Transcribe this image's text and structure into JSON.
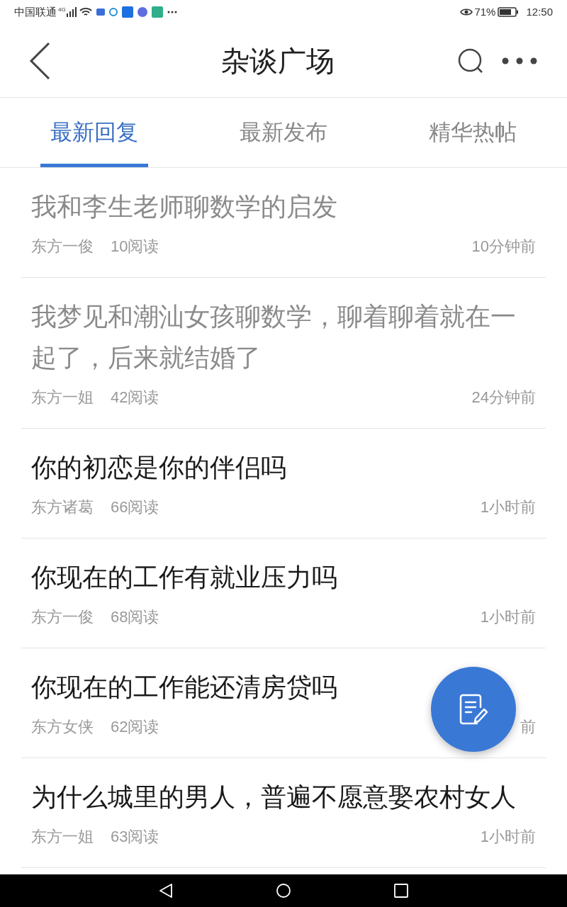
{
  "status_bar": {
    "carrier": "中国联通",
    "network": "4G",
    "battery": "71%",
    "time": "12:50"
  },
  "header": {
    "title": "杂谈广场"
  },
  "tabs": [
    {
      "label": "最新回复",
      "selected": true
    },
    {
      "label": "最新发布",
      "selected": false
    },
    {
      "label": "精华热帖",
      "selected": false
    }
  ],
  "posts": [
    {
      "title": "我和李生老师聊数学的启发",
      "author": "东方一俊",
      "reads": "10阅读",
      "time": "10分钟前",
      "read": true
    },
    {
      "title": "我梦见和潮汕女孩聊数学，聊着聊着就在一起了，后来就结婚了",
      "author": "东方一姐",
      "reads": "42阅读",
      "time": "24分钟前",
      "read": true
    },
    {
      "title": "你的初恋是你的伴侣吗",
      "author": "东方诸葛",
      "reads": "66阅读",
      "time": "1小时前",
      "read": false
    },
    {
      "title": "你现在的工作有就业压力吗",
      "author": "东方一俊",
      "reads": "68阅读",
      "time": "1小时前",
      "read": false
    },
    {
      "title": "你现在的工作能还清房贷吗",
      "author": "东方女侠",
      "reads": "62阅读",
      "time": "前",
      "read": false
    },
    {
      "title": "为什么城里的男人，普遍不愿意娶农村女人",
      "author": "东方一姐",
      "reads": "63阅读",
      "time": "1小时前",
      "read": false
    }
  ]
}
